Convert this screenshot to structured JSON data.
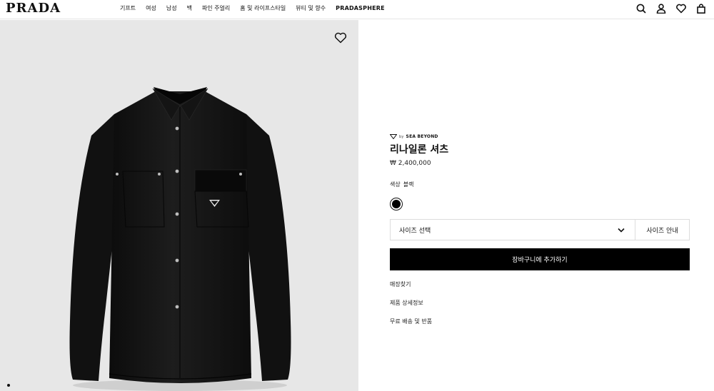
{
  "header": {
    "logo": "PRADA",
    "nav": [
      "기프트",
      "여성",
      "남성",
      "백",
      "파인 주얼리",
      "홈 및 라이프스타일",
      "뷰티 및 향수",
      "PRADASPHERE"
    ],
    "icons": [
      "search-icon",
      "account-icon",
      "wishlist-icon",
      "bag-icon"
    ]
  },
  "gallery": {
    "wishlist_icon": "heart-icon",
    "pagination_dots": 1
  },
  "product": {
    "brand_by": "by",
    "brand_name": "SEA BEYOND",
    "title": "리나일론 셔츠",
    "price": "₩ 2,400,000",
    "color_label": "색상",
    "color_value": "블랙",
    "swatch_color": "#000000",
    "size_select_label": "사이즈 선택",
    "size_guide_label": "사이즈 안내",
    "add_to_cart_label": "장바구니에 추가하기",
    "links": [
      "매장찾기",
      "제품 상세정보",
      "무료 배송 및 반품"
    ]
  },
  "colors": {
    "accent": "#000000",
    "image_bg": "#e7e7e7"
  }
}
